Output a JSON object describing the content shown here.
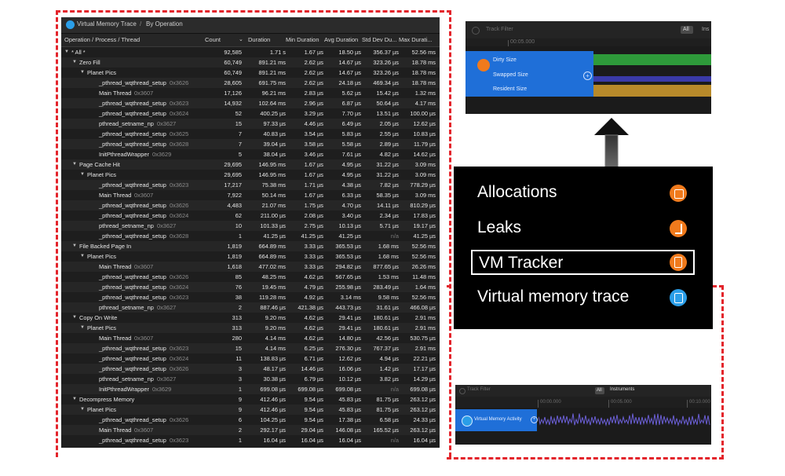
{
  "table_panel": {
    "breadcrumb": {
      "root": "Virtual Memory Trace",
      "separator": "/",
      "mode": "By Operation"
    },
    "columns": {
      "operation": "Operation / Process / Thread",
      "count": "Count",
      "duration": "Duration",
      "min": "Min Duration",
      "avg": "Avg Duration",
      "std": "Std Dev Du...",
      "max": "Max Durati..."
    },
    "rows": [
      {
        "level": 0,
        "disclosure": "▼",
        "name": "* All *",
        "addr": "",
        "count": "92,585",
        "dur": "1.71 s",
        "min": "1.67 µs",
        "avg": "18.50 µs",
        "std": "356.37 µs",
        "max": "52.56 ms"
      },
      {
        "level": 1,
        "disclosure": "▼",
        "name": "Zero Fill",
        "addr": "",
        "count": "60,749",
        "dur": "891.21 ms",
        "min": "2.62 µs",
        "avg": "14.67 µs",
        "std": "323.26 µs",
        "max": "18.78 ms"
      },
      {
        "level": 2,
        "disclosure": "▼",
        "name": "Planet Pics",
        "addr": "",
        "count": "60,749",
        "dur": "891.21 ms",
        "min": "2.62 µs",
        "avg": "14.67 µs",
        "std": "323.26 µs",
        "max": "18.78 ms"
      },
      {
        "level": 3,
        "disclosure": "",
        "name": "_pthread_wqthread_setup",
        "addr": "0x3626",
        "count": "28,605",
        "dur": "691.75 ms",
        "min": "2.62 µs",
        "avg": "24.18 µs",
        "std": "469.34 µs",
        "max": "18.78 ms"
      },
      {
        "level": 3,
        "disclosure": "",
        "name": "Main Thread",
        "addr": "0x3607",
        "count": "17,126",
        "dur": "96.21 ms",
        "min": "2.83 µs",
        "avg": "5.62 µs",
        "std": "15.42 µs",
        "max": "1.32 ms"
      },
      {
        "level": 3,
        "disclosure": "",
        "name": "_pthread_wqthread_setup",
        "addr": "0x3623",
        "count": "14,932",
        "dur": "102.64 ms",
        "min": "2.96 µs",
        "avg": "6.87 µs",
        "std": "50.64 µs",
        "max": "4.17 ms"
      },
      {
        "level": 3,
        "disclosure": "",
        "name": "_pthread_wqthread_setup",
        "addr": "0x3624",
        "count": "52",
        "dur": "400.25 µs",
        "min": "3.29 µs",
        "avg": "7.70 µs",
        "std": "13.51 µs",
        "max": "100.00 µs"
      },
      {
        "level": 3,
        "disclosure": "",
        "name": "pthread_setname_np",
        "addr": "0x3627",
        "count": "15",
        "dur": "97.33 µs",
        "min": "4.46 µs",
        "avg": "6.49 µs",
        "std": "2.05 µs",
        "max": "12.62 µs"
      },
      {
        "level": 3,
        "disclosure": "",
        "name": "_pthread_wqthread_setup",
        "addr": "0x3625",
        "count": "7",
        "dur": "40.83 µs",
        "min": "3.54 µs",
        "avg": "5.83 µs",
        "std": "2.55 µs",
        "max": "10.83 µs"
      },
      {
        "level": 3,
        "disclosure": "",
        "name": "_pthread_wqthread_setup",
        "addr": "0x3628",
        "count": "7",
        "dur": "39.04 µs",
        "min": "3.58 µs",
        "avg": "5.58 µs",
        "std": "2.89 µs",
        "max": "11.79 µs"
      },
      {
        "level": 3,
        "disclosure": "",
        "name": "InitPthreadWrapper",
        "addr": "0x3629",
        "count": "5",
        "dur": "38.04 µs",
        "min": "3.46 µs",
        "avg": "7.61 µs",
        "std": "4.82 µs",
        "max": "14.62 µs"
      },
      {
        "level": 1,
        "disclosure": "▼",
        "name": "Page Cache Hit",
        "addr": "",
        "count": "29,695",
        "dur": "146.95 ms",
        "min": "1.67 µs",
        "avg": "4.95 µs",
        "std": "31.22 µs",
        "max": "3.09 ms"
      },
      {
        "level": 2,
        "disclosure": "▼",
        "name": "Planet Pics",
        "addr": "",
        "count": "29,695",
        "dur": "146.95 ms",
        "min": "1.67 µs",
        "avg": "4.95 µs",
        "std": "31.22 µs",
        "max": "3.09 ms"
      },
      {
        "level": 3,
        "disclosure": "",
        "name": "_pthread_wqthread_setup",
        "addr": "0x3623",
        "count": "17,217",
        "dur": "75.38 ms",
        "min": "1.71 µs",
        "avg": "4.38 µs",
        "std": "7.82 µs",
        "max": "778.29 µs"
      },
      {
        "level": 3,
        "disclosure": "",
        "name": "Main Thread",
        "addr": "0x3607",
        "count": "7,922",
        "dur": "50.14 ms",
        "min": "1.67 µs",
        "avg": "6.33 µs",
        "std": "58.35 µs",
        "max": "3.09 ms"
      },
      {
        "level": 3,
        "disclosure": "",
        "name": "_pthread_wqthread_setup",
        "addr": "0x3626",
        "count": "4,483",
        "dur": "21.07 ms",
        "min": "1.75 µs",
        "avg": "4.70 µs",
        "std": "14.11 µs",
        "max": "810.29 µs"
      },
      {
        "level": 3,
        "disclosure": "",
        "name": "_pthread_wqthread_setup",
        "addr": "0x3624",
        "count": "62",
        "dur": "211.00 µs",
        "min": "2.08 µs",
        "avg": "3.40 µs",
        "std": "2.34 µs",
        "max": "17.83 µs"
      },
      {
        "level": 3,
        "disclosure": "",
        "name": "pthread_setname_np",
        "addr": "0x3627",
        "count": "10",
        "dur": "101.33 µs",
        "min": "2.75 µs",
        "avg": "10.13 µs",
        "std": "5.71 µs",
        "max": "19.17 µs"
      },
      {
        "level": 3,
        "disclosure": "",
        "name": "_pthread_wqthread_setup",
        "addr": "0x3628",
        "count": "1",
        "dur": "41.25 µs",
        "min": "41.25 µs",
        "avg": "41.25 µs",
        "std": "n/a",
        "max": "41.25 µs"
      },
      {
        "level": 1,
        "disclosure": "▼",
        "name": "File Backed Page In",
        "addr": "",
        "count": "1,819",
        "dur": "664.89 ms",
        "min": "3.33 µs",
        "avg": "365.53 µs",
        "std": "1.68 ms",
        "max": "52.56 ms"
      },
      {
        "level": 2,
        "disclosure": "▼",
        "name": "Planet Pics",
        "addr": "",
        "count": "1,819",
        "dur": "664.89 ms",
        "min": "3.33 µs",
        "avg": "365.53 µs",
        "std": "1.68 ms",
        "max": "52.56 ms"
      },
      {
        "level": 3,
        "disclosure": "",
        "name": "Main Thread",
        "addr": "0x3607",
        "count": "1,618",
        "dur": "477.02 ms",
        "min": "3.33 µs",
        "avg": "294.82 µs",
        "std": "877.65 µs",
        "max": "26.26 ms"
      },
      {
        "level": 3,
        "disclosure": "",
        "name": "_pthread_wqthread_setup",
        "addr": "0x3626",
        "count": "85",
        "dur": "48.25 ms",
        "min": "4.62 µs",
        "avg": "567.65 µs",
        "std": "1.53 ms",
        "max": "11.48 ms"
      },
      {
        "level": 3,
        "disclosure": "",
        "name": "_pthread_wqthread_setup",
        "addr": "0x3624",
        "count": "76",
        "dur": "19.45 ms",
        "min": "4.79 µs",
        "avg": "255.98 µs",
        "std": "283.49 µs",
        "max": "1.64 ms"
      },
      {
        "level": 3,
        "disclosure": "",
        "name": "_pthread_wqthread_setup",
        "addr": "0x3623",
        "count": "38",
        "dur": "119.28 ms",
        "min": "4.92 µs",
        "avg": "3.14 ms",
        "std": "9.58 ms",
        "max": "52.56 ms"
      },
      {
        "level": 3,
        "disclosure": "",
        "name": "pthread_setname_np",
        "addr": "0x3627",
        "count": "2",
        "dur": "887.46 µs",
        "min": "421.38 µs",
        "avg": "443.73 µs",
        "std": "31.61 µs",
        "max": "466.08 µs"
      },
      {
        "level": 1,
        "disclosure": "▼",
        "name": "Copy On Write",
        "addr": "",
        "count": "313",
        "dur": "9.20 ms",
        "min": "4.62 µs",
        "avg": "29.41 µs",
        "std": "180.61 µs",
        "max": "2.91 ms"
      },
      {
        "level": 2,
        "disclosure": "▼",
        "name": "Planet Pics",
        "addr": "",
        "count": "313",
        "dur": "9.20 ms",
        "min": "4.62 µs",
        "avg": "29.41 µs",
        "std": "180.61 µs",
        "max": "2.91 ms"
      },
      {
        "level": 3,
        "disclosure": "",
        "name": "Main Thread",
        "addr": "0x3607",
        "count": "280",
        "dur": "4.14 ms",
        "min": "4.62 µs",
        "avg": "14.80 µs",
        "std": "42.56 µs",
        "max": "530.75 µs"
      },
      {
        "level": 3,
        "disclosure": "",
        "name": "_pthread_wqthread_setup",
        "addr": "0x3623",
        "count": "15",
        "dur": "4.14 ms",
        "min": "6.25 µs",
        "avg": "276.30 µs",
        "std": "767.37 µs",
        "max": "2.91 ms"
      },
      {
        "level": 3,
        "disclosure": "",
        "name": "_pthread_wqthread_setup",
        "addr": "0x3624",
        "count": "11",
        "dur": "138.83 µs",
        "min": "6.71 µs",
        "avg": "12.62 µs",
        "std": "4.94 µs",
        "max": "22.21 µs"
      },
      {
        "level": 3,
        "disclosure": "",
        "name": "_pthread_wqthread_setup",
        "addr": "0x3626",
        "count": "3",
        "dur": "48.17 µs",
        "min": "14.46 µs",
        "avg": "16.06 µs",
        "std": "1.42 µs",
        "max": "17.17 µs"
      },
      {
        "level": 3,
        "disclosure": "",
        "name": "pthread_setname_np",
        "addr": "0x3627",
        "count": "3",
        "dur": "30.38 µs",
        "min": "6.79 µs",
        "avg": "10.12 µs",
        "std": "3.82 µs",
        "max": "14.29 µs"
      },
      {
        "level": 3,
        "disclosure": "",
        "name": "InitPthreadWrapper",
        "addr": "0x3629",
        "count": "1",
        "dur": "699.08 µs",
        "min": "699.08 µs",
        "avg": "699.08 µs",
        "std": "n/a",
        "max": "699.08 µs"
      },
      {
        "level": 1,
        "disclosure": "▼",
        "name": "Decompress Memory",
        "addr": "",
        "count": "9",
        "dur": "412.46 µs",
        "min": "9.54 µs",
        "avg": "45.83 µs",
        "std": "81.75 µs",
        "max": "263.12 µs"
      },
      {
        "level": 2,
        "disclosure": "▼",
        "name": "Planet Pics",
        "addr": "",
        "count": "9",
        "dur": "412.46 µs",
        "min": "9.54 µs",
        "avg": "45.83 µs",
        "std": "81.75 µs",
        "max": "263.12 µs"
      },
      {
        "level": 3,
        "disclosure": "",
        "name": "_pthread_wqthread_setup",
        "addr": "0x3626",
        "count": "6",
        "dur": "104.25 µs",
        "min": "9.54 µs",
        "avg": "17.38 µs",
        "std": "6.58 µs",
        "max": "24.33 µs"
      },
      {
        "level": 3,
        "disclosure": "",
        "name": "Main Thread",
        "addr": "0x3607",
        "count": "2",
        "dur": "292.17 µs",
        "min": "29.04 µs",
        "avg": "146.08 µs",
        "std": "165.52 µs",
        "max": "263.12 µs"
      },
      {
        "level": 3,
        "disclosure": "",
        "name": "_pthread_wqthread_setup",
        "addr": "0x3623",
        "count": "1",
        "dur": "16.04 µs",
        "min": "16.04 µs",
        "avg": "16.04 µs",
        "std": "n/a",
        "max": "16.04 µs"
      }
    ]
  },
  "vm_tracker_thumb": {
    "track_filter": "Track Filter",
    "all_button": "All",
    "truncated_tab": "Ins",
    "timeline_tick": "00:05.000",
    "tracks": [
      "Dirty Size",
      "Swapped Size",
      "Resident Size"
    ],
    "colors": {
      "selected_bg": "#1f6fd8",
      "dirty": "#2e9a3a",
      "swapped": "#3a3aa8",
      "resident": "#b88a2a",
      "icon": "#f07a1c"
    }
  },
  "instrument_menu": {
    "items": [
      {
        "label": "Allocations",
        "icon": "allocations-icon",
        "color": "#f07a1c"
      },
      {
        "label": "Leaks",
        "icon": "leaks-icon",
        "color": "#f07a1c"
      },
      {
        "label": "VM Tracker",
        "icon": "vm-tracker-icon",
        "color": "#f07a1c",
        "selected": true
      },
      {
        "label": "Virtual memory trace",
        "icon": "virtual-memory-trace-icon",
        "color": "#2b9ee8"
      }
    ]
  },
  "activity_thumb": {
    "track_filter": "Track Filter",
    "all_button": "All",
    "instruments_tab": "Instruments",
    "timeline_ticks": [
      "00:00.000",
      "00:05.000",
      "00:10.000"
    ],
    "track_label": "Virtual Memory Activity",
    "colors": {
      "track_bg": "#1f6fd8",
      "waveform": "#6b5fd6"
    }
  },
  "colors": {
    "highlight": "#e3242b",
    "panel_bg": "#1e1e1e",
    "menu_bg": "#000000"
  }
}
